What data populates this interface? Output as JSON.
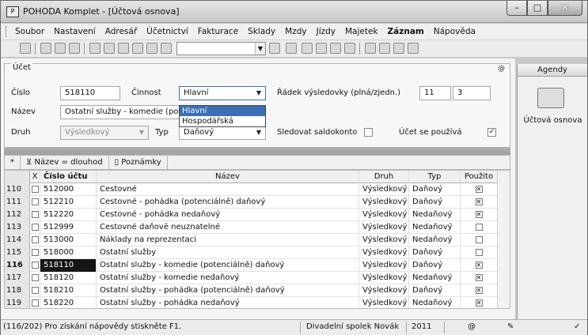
{
  "window": {
    "title": "POHODA Komplet - [Účtová osnova]",
    "app_icon": "pohoda-icon"
  },
  "menu": [
    "Soubor",
    "Nastavení",
    "Adresář",
    "Účetnictví",
    "Fakturace",
    "Sklady",
    "Mzdy",
    "Jízdy",
    "Majetek",
    "Záznam",
    "Nápověda"
  ],
  "form": {
    "group": "Účet",
    "at_icon": "@",
    "cislo_label": "Číslo",
    "cislo_value": "518110",
    "cinnost_label": "Činnost",
    "cinnost_value": "Hlavní",
    "cinnost_options": [
      "Hlavní",
      "Hospodářská"
    ],
    "nazev_label": "Název",
    "nazev_value": "Ostatní služby - komedie  (pote",
    "druh_label": "Druh",
    "druh_value": "Výsledkový",
    "typ_label": "Typ",
    "typ_value": "Daňový",
    "radek_label": "Řádek výsledovky (plná/zjedn.)",
    "radek_plna": "11",
    "radek_zjedn": "3",
    "saldo_label": "Sledovat saldokonto",
    "pouziva_label": "Účet se používá"
  },
  "tabs": {
    "star": "*",
    "filter": "Název = dlouhod",
    "notes": "Poznámky"
  },
  "table": {
    "headers": {
      "x": "X",
      "cislo": "Číslo účtu",
      "nazev": "Název",
      "druh": "Druh",
      "typ": "Typ",
      "pouzito": "Použito"
    },
    "rows": [
      {
        "n": "110",
        "cislo": "512000",
        "nazev": "Cestovné",
        "druh": "Výsledkový",
        "typ": "Daňový",
        "pouzito": true
      },
      {
        "n": "111",
        "cislo": "512210",
        "nazev": "Cestovné - pohádka    (potenciálně) daňový",
        "druh": "Výsledkový",
        "typ": "Daňový",
        "pouzito": true
      },
      {
        "n": "112",
        "cislo": "512220",
        "nazev": "Cestovné - pohádka    nedaňový",
        "druh": "Výsledkový",
        "typ": "Nedaňový",
        "pouzito": true
      },
      {
        "n": "113",
        "cislo": "512999",
        "nazev": "Cestovné daňově neuznatelné",
        "druh": "Výsledkový",
        "typ": "Nedaňový",
        "pouzito": false
      },
      {
        "n": "114",
        "cislo": "513000",
        "nazev": "Náklady na reprezentaci",
        "druh": "Výsledkový",
        "typ": "Nedaňový",
        "pouzito": false
      },
      {
        "n": "115",
        "cislo": "518000",
        "nazev": "Ostatní služby",
        "druh": "Výsledkový",
        "typ": "Daňový",
        "pouzito": false
      },
      {
        "n": "116",
        "cislo": "518110",
        "nazev": "Ostatní služby - komedie  (potenciálně) daňový",
        "druh": "Výsledkový",
        "typ": "Daňový",
        "pouzito": true
      },
      {
        "n": "117",
        "cislo": "518120",
        "nazev": "Ostatní služby - komedie  nedaňový",
        "druh": "Výsledkový",
        "typ": "Nedaňový",
        "pouzito": true
      },
      {
        "n": "118",
        "cislo": "518210",
        "nazev": "Ostatní služby - pohádka  (potenciálně) daňový",
        "druh": "Výsledkový",
        "typ": "Daňový",
        "pouzito": true
      },
      {
        "n": "119",
        "cislo": "518220",
        "nazev": "Ostatní služby - pohádka  nedaňový",
        "druh": "Výsledkový",
        "typ": "Nedaňový",
        "pouzito": true
      }
    ]
  },
  "status": {
    "help": "(116/202) Pro získání nápovědy stiskněte F1.",
    "company": "Divadelní spolek Novák",
    "year": "2011",
    "at": "@"
  },
  "agendy": {
    "title": "Agendy",
    "item": "Účtová osnova"
  }
}
